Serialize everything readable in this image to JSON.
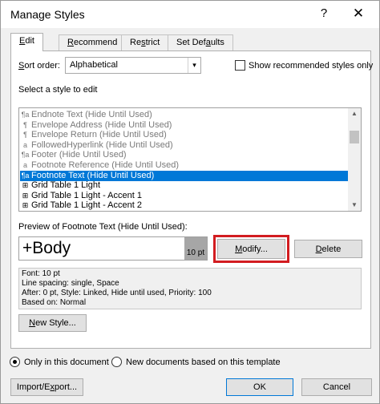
{
  "window": {
    "title": "Manage Styles",
    "help": "?",
    "close": "✕"
  },
  "tabs": [
    {
      "label": "Edit",
      "accel": "E",
      "rest": "dit"
    },
    {
      "label": "Recommend",
      "accel": "R",
      "rest": "ecommend"
    },
    {
      "label": "Restrict",
      "pre": "Re",
      "accel": "s",
      "rest": "trict"
    },
    {
      "label": "Set Defaults",
      "pre": "Set Def",
      "accel": "a",
      "rest": "ults"
    }
  ],
  "sort": {
    "label_accel": "S",
    "label_rest": "ort order:",
    "value": "Alphabetical",
    "arrow": "▾"
  },
  "show_recommended": {
    "label": "Show recommended styles only",
    "checked": false
  },
  "select_label": "Select a style to edit",
  "styles": [
    {
      "icon": "¶a",
      "name": "Endnote Text  (Hide Until Used)",
      "gray": true
    },
    {
      "icon": "¶",
      "name": "Envelope Address  (Hide Until Used)",
      "gray": true
    },
    {
      "icon": "¶",
      "name": "Envelope Return  (Hide Until Used)",
      "gray": true
    },
    {
      "icon": "a",
      "name": "FollowedHyperlink  (Hide Until Used)",
      "gray": true
    },
    {
      "icon": "¶a",
      "name": "Footer  (Hide Until Used)",
      "gray": true
    },
    {
      "icon": "a",
      "name": "Footnote Reference  (Hide Until Used)",
      "gray": true
    },
    {
      "icon": "¶a",
      "name": "Footnote Text  (Hide Until Used)",
      "selected": true
    },
    {
      "icon": "⊞",
      "name": "Grid Table 1 Light"
    },
    {
      "icon": "⊞",
      "name": "Grid Table 1 Light - Accent 1"
    },
    {
      "icon": "⊞",
      "name": "Grid Table 1 Light - Accent 2"
    }
  ],
  "scroll": {
    "up": "▲",
    "down": "▼"
  },
  "preview": {
    "label": "Preview of Footnote Text  (Hide Until Used):",
    "text": "+Body",
    "size": "10 pt"
  },
  "buttons": {
    "modify_accel": "M",
    "modify_rest": "odify...",
    "delete_accel": "D",
    "delete_rest": "elete",
    "new_style_accel": "N",
    "new_style_rest": "ew Style...",
    "import_export_pre": "Import/E",
    "import_export_accel": "x",
    "import_export_rest": "port...",
    "ok": "OK",
    "cancel": "Cancel"
  },
  "description": [
    "Font: 10 pt",
    "    Line spacing:  single, Space",
    "    After:  0 pt, Style: Linked, Hide until used, Priority: 100",
    "    Based on: Normal"
  ],
  "scope": {
    "this_doc": "Only in this document",
    "template": "New documents based on this template",
    "selected": "this_doc"
  },
  "colors": {
    "selection": "#0078d7",
    "highlight_box": "#d21c20"
  }
}
